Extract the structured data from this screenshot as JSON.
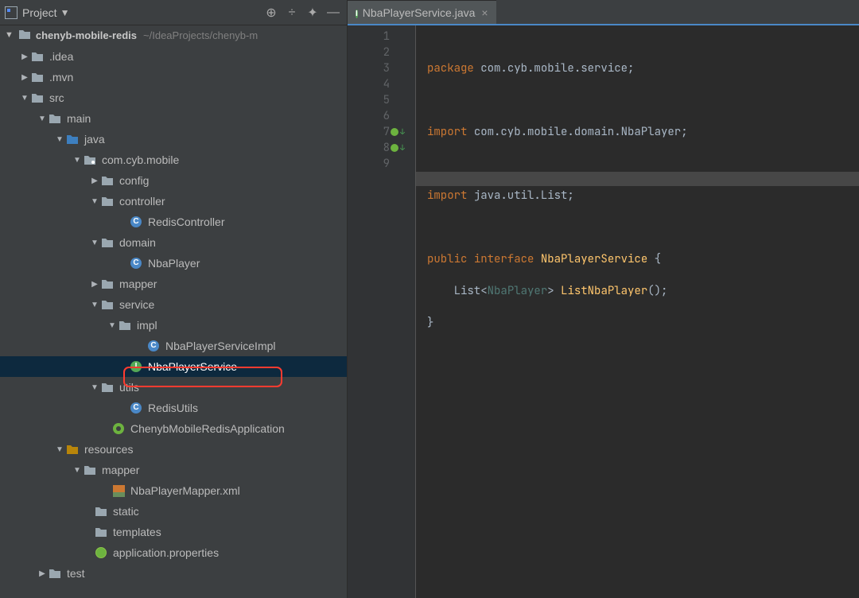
{
  "sidebar": {
    "title": "Project",
    "project_name": "chenyb-mobile-redis",
    "project_path": "~/IdeaProjects/chenyb-m"
  },
  "tree": {
    "idea": ".idea",
    "mvn": ".mvn",
    "src": "src",
    "main": "main",
    "java": "java",
    "package": "com.cyb.mobile",
    "config": "config",
    "controller": "controller",
    "redisController": "RedisController",
    "domain": "domain",
    "nbaPlayer": "NbaPlayer",
    "mapper": "mapper",
    "service": "service",
    "impl": "impl",
    "nbaPlayerServiceImpl": "NbaPlayerServiceImpl",
    "nbaPlayerService": "NbaPlayerService",
    "utils": "utils",
    "redisUtils": "RedisUtils",
    "chenybApp": "ChenybMobileRedisApplication",
    "resources": "resources",
    "mapperDir": "mapper",
    "nbaPlayerMapperXml": "NbaPlayerMapper.xml",
    "static": "static",
    "templates": "templates",
    "appProps": "application.properties",
    "test": "test"
  },
  "tab": {
    "filename": "NbaPlayerService.java"
  },
  "code": {
    "lines": [
      "1",
      "2",
      "3",
      "4",
      "5",
      "6",
      "7",
      "8",
      "9"
    ],
    "l1_kw": "package",
    "l1_pkg": "com.cyb.mobile.service",
    "l3_kw": "import",
    "l3_path": "com.cyb.mobile.domain.NbaPlayer",
    "l5_kw": "import",
    "l5_path": "java.util.List",
    "l7_kw1": "public",
    "l7_kw2": "interface",
    "l7_name": "NbaPlayerService",
    "l8_type": "List",
    "l8_generic": "NbaPlayer",
    "l8_method": "ListNbaPlayer"
  }
}
